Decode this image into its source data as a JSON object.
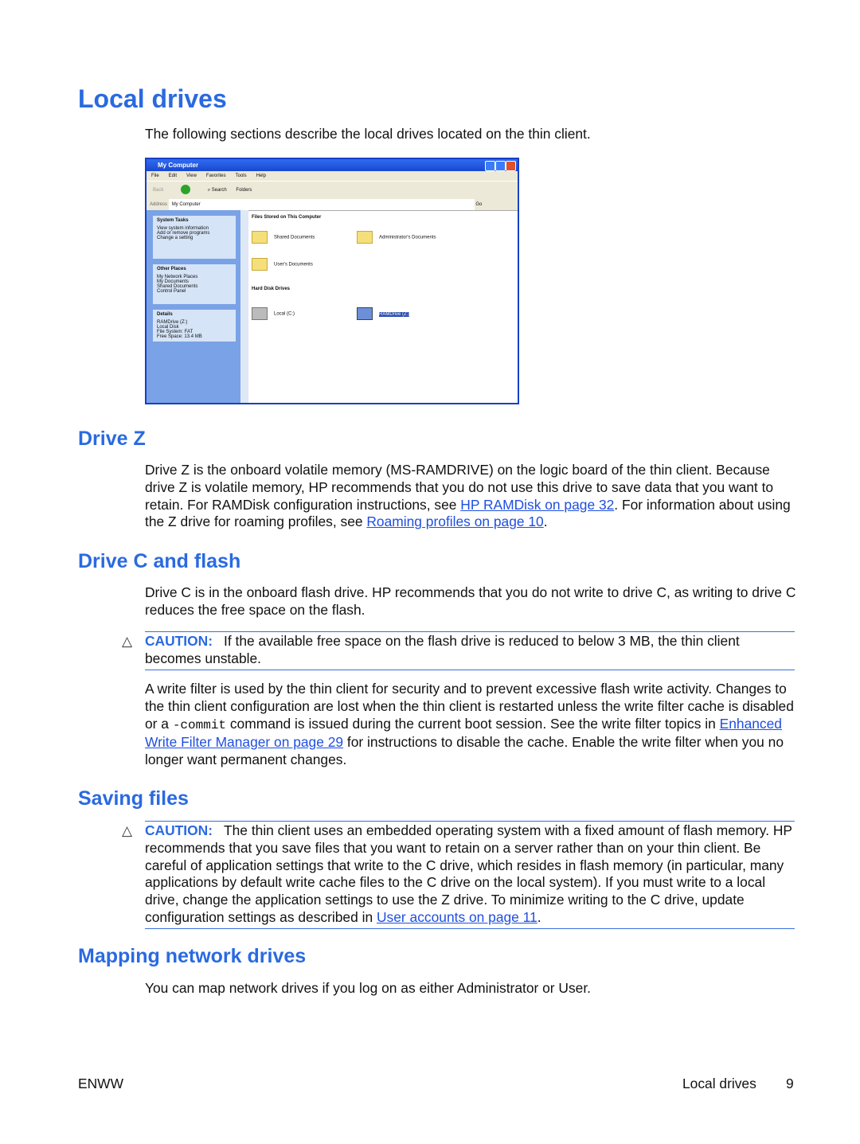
{
  "title": "Local drives",
  "intro": "The following sections describe the local drives located on the thin client.",
  "screenshot": {
    "window_title": "My Computer",
    "menu": [
      "File",
      "Edit",
      "View",
      "Favorites",
      "Tools",
      "Help"
    ],
    "toolbar": [
      "Back",
      "Search",
      "Folders"
    ],
    "address_label": "Address",
    "address_value": "My Computer",
    "go": "Go",
    "system_tasks": {
      "title": "System Tasks",
      "items": [
        "View system information",
        "Add or remove programs",
        "Change a setting"
      ]
    },
    "other_places": {
      "title": "Other Places",
      "items": [
        "My Network Places",
        "My Documents",
        "Shared Documents",
        "Control Panel"
      ]
    },
    "details": {
      "title": "Details",
      "items": [
        "RAMDrive (Z:)",
        "Local Disk",
        "File System: FAT",
        "Free Space: 13.4 MB"
      ]
    },
    "files_header": "Files Stored on This Computer",
    "folders": [
      "Shared Documents",
      "Administrator's Documents",
      "User's Documents"
    ],
    "drives_header": "Hard Disk Drives",
    "drives": [
      "Local (C:)",
      "RAMDrive (Z:)"
    ]
  },
  "drive_z": {
    "heading": "Drive Z",
    "t1": "Drive Z is the onboard volatile memory (MS-RAMDRIVE) on the logic board of the thin client. Because drive Z is volatile memory, HP recommends that you do not use this drive to save data that you want to retain. For RAMDisk configuration instructions, see ",
    "link1": "HP RAMDisk on page 32",
    "t2": ". For information about using the Z drive for roaming profiles, see ",
    "link2": "Roaming profiles on page 10",
    "t3": "."
  },
  "drive_c": {
    "heading": "Drive C and flash",
    "p1": "Drive C is in the onboard flash drive. HP recommends that you do not write to drive C, as writing to drive C reduces the free space on the flash.",
    "caution_label": "CAUTION:",
    "caution": "If the available free space on the flash drive is reduced to below 3 MB, the thin client becomes unstable.",
    "p2a": "A write filter is used by the thin client for security and to prevent excessive flash write activity. Changes to the thin client configuration are lost when the thin client is restarted unless the write filter cache is disabled or a ",
    "p2code": "-commit",
    "p2b": " command is issued during the current boot session. See the write filter topics in ",
    "p2link": "Enhanced Write Filter Manager on page 29",
    "p2c": " for instructions to disable the cache. Enable the write filter when you no longer want permanent changes."
  },
  "saving": {
    "heading": "Saving files",
    "caution_label": "CAUTION:",
    "caution": "The thin client uses an embedded operating system with a fixed amount of flash memory. HP recommends that you save files that you want to retain on a server rather than on your thin client. Be careful of application settings that write to the C drive, which resides in flash memory (in particular, many applications by default write cache files to the C drive on the local system). If you must write to a local drive, change the application settings to use the Z drive. To minimize writing to the C drive, update configuration settings as described in ",
    "link": "User accounts on page 11",
    "end": "."
  },
  "mapping": {
    "heading": "Mapping network drives",
    "p": "You can map network drives if you log on as either Administrator or User."
  },
  "footer": {
    "left": "ENWW",
    "section": "Local drives",
    "page": "9"
  }
}
